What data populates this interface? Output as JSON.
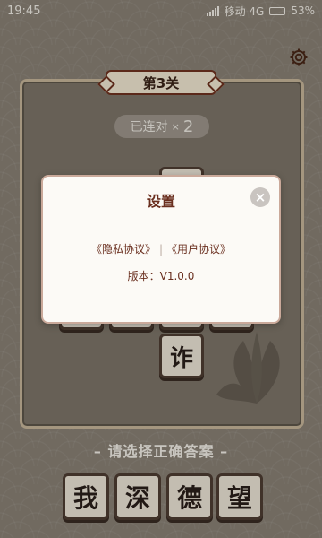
{
  "status_bar": {
    "time": "19:45",
    "carrier": "移动 4G",
    "battery": "53%"
  },
  "game": {
    "level_title": "第3关",
    "combo_label": "已连对",
    "combo_times": "×",
    "combo_count": "2",
    "visible_tile": "诈",
    "hint": "– 请选择正确答案 –",
    "answers": [
      "我",
      "深",
      "德",
      "望"
    ]
  },
  "dialog": {
    "title": "设置",
    "privacy_link": "《隐私协议》",
    "separator": "|",
    "user_link": "《用户协议》",
    "version": "版本：V1.0.0",
    "close_symbol": "×"
  },
  "colors": {
    "accent": "#6a2f1f",
    "tile_bg": "#eee7d8"
  }
}
